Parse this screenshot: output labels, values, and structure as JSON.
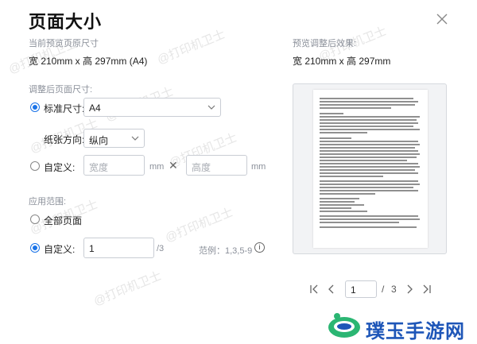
{
  "dialog": {
    "title": "页面大小",
    "current_size_label": "当前预览页原尺寸",
    "current_size_value": "宽 210mm x 高 297mm (A4)",
    "preview_label": "预览调整后效果:",
    "preview_size_value": "宽 210mm x 高 297mm"
  },
  "adjust": {
    "section_label": "调整后页面尺寸:",
    "standard_label": "标准尺寸:",
    "standard_value": "A4",
    "orientation_label": "纸张方向:",
    "orientation_value": "纵向",
    "custom_label": "自定义:",
    "width_placeholder": "宽度",
    "height_placeholder": "高度",
    "unit": "mm",
    "times": "✕"
  },
  "range": {
    "section_label": "应用范围:",
    "all_pages_label": "全部页面",
    "custom_label": "自定义:",
    "custom_value": "1",
    "total_suffix": "/3",
    "example_label": "范例：1,3,5-9",
    "info": "i"
  },
  "pager": {
    "current": "1",
    "separator": "/",
    "total": "3"
  },
  "watermark": {
    "text": "@打印机卫士",
    "brand": "璞玉手游网"
  },
  "colors": {
    "accent": "#1a73e8",
    "brand": "#1e56b8"
  }
}
